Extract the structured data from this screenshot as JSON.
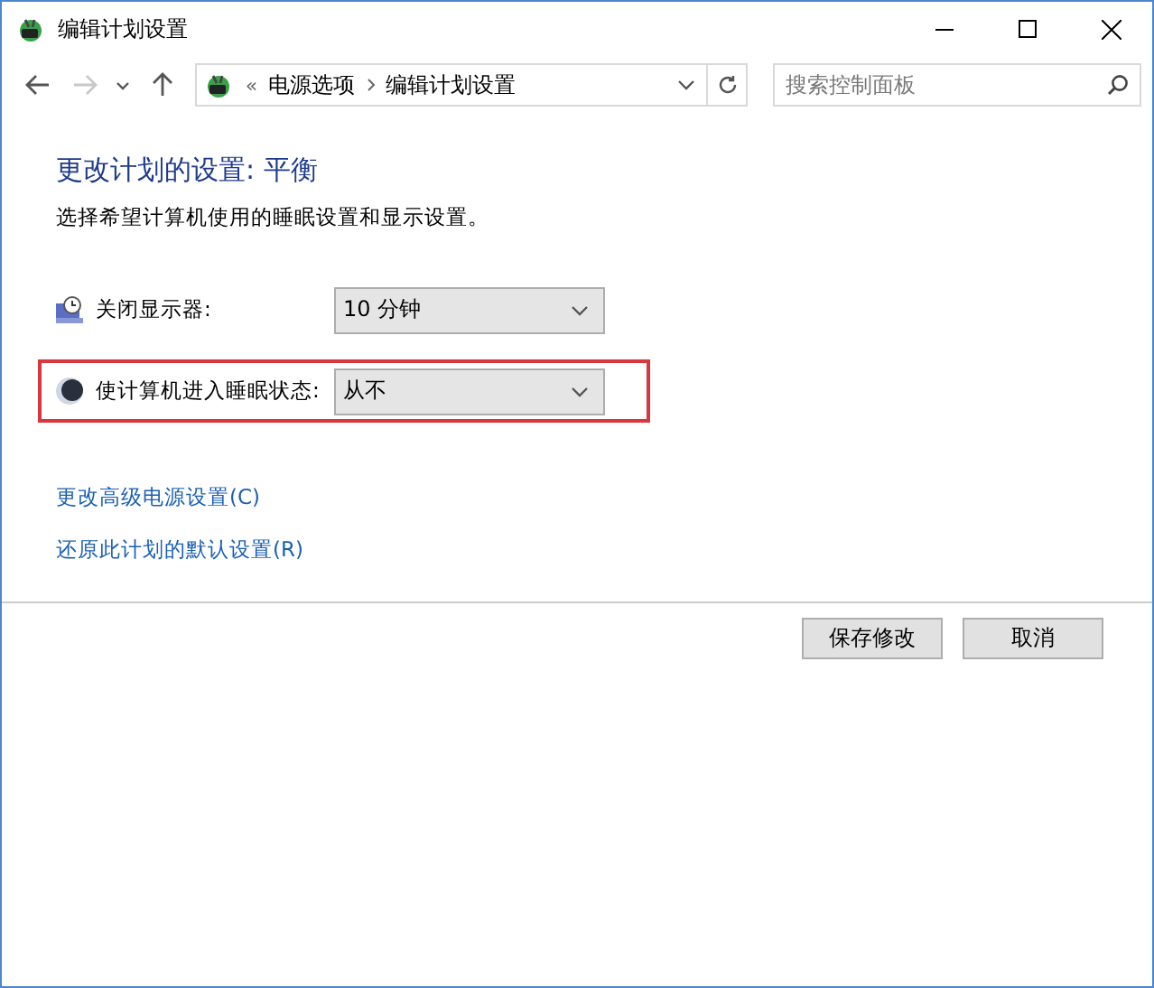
{
  "window": {
    "title": "编辑计划设置"
  },
  "navigation": [
    {
      "kind": "back",
      "disabled": false
    },
    {
      "kind": "forward",
      "disabled": true
    },
    {
      "kind": "recent",
      "disabled": false
    },
    {
      "kind": "up",
      "disabled": false
    }
  ],
  "address_bar": {
    "overflow": "«",
    "path": [
      "电源选项",
      "编辑计划设置"
    ]
  },
  "search": {
    "placeholder": "搜索控制面板"
  },
  "heading": "更改计划的设置: 平衡",
  "description": "选择希望计算机使用的睡眠设置和显示设置。",
  "settings": [
    {
      "kind": "display",
      "label": "关闭显示器:",
      "value": "10 分钟",
      "highlighted": false
    },
    {
      "kind": "sleep",
      "label": "使计算机进入睡眠状态:",
      "value": "从不",
      "highlighted": true
    }
  ],
  "links": [
    "更改高级电源设置(C)",
    "还原此计划的默认设置(R)"
  ],
  "buttons": [
    "保存修改",
    "取消"
  ]
}
